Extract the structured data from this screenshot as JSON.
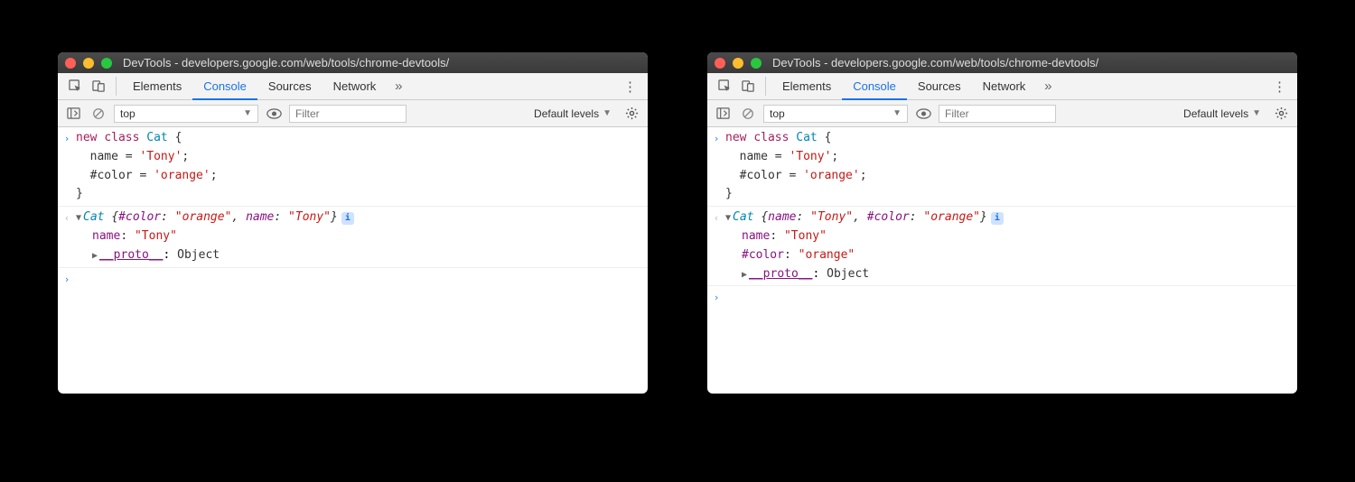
{
  "windows": [
    {
      "title": "DevTools - developers.google.com/web/tools/chrome-devtools/",
      "tabs": {
        "items": [
          "Elements",
          "Console",
          "Sources",
          "Network"
        ],
        "active": "Console"
      },
      "toolbar": {
        "context": "top",
        "filter_placeholder": "Filter",
        "levels": "Default levels"
      },
      "console": {
        "input_lines": [
          {
            "tokens": [
              {
                "t": "kw",
                "s": "new "
              },
              {
                "t": "kw",
                "s": "class "
              },
              {
                "t": "cls",
                "s": "Cat"
              },
              {
                "t": "plain",
                "s": " {"
              }
            ]
          },
          {
            "tokens": [
              {
                "t": "plain",
                "s": "  name = "
              },
              {
                "t": "str",
                "s": "'Tony'"
              },
              {
                "t": "plain",
                "s": ";"
              }
            ]
          },
          {
            "tokens": [
              {
                "t": "plain",
                "s": "  #color = "
              },
              {
                "t": "str",
                "s": "'orange'"
              },
              {
                "t": "plain",
                "s": ";"
              }
            ]
          },
          {
            "tokens": [
              {
                "t": "plain",
                "s": "}"
              }
            ]
          }
        ],
        "output": {
          "header_tokens": [
            {
              "t": "cls",
              "s": "Cat "
            },
            {
              "t": "plain",
              "s": "{"
            },
            {
              "t": "attr",
              "s": "#color"
            },
            {
              "t": "plain",
              "s": ": "
            },
            {
              "t": "str",
              "s": "\"orange\""
            },
            {
              "t": "plain",
              "s": ", "
            },
            {
              "t": "attr",
              "s": "name"
            },
            {
              "t": "plain",
              "s": ": "
            },
            {
              "t": "str",
              "s": "\"Tony\""
            },
            {
              "t": "plain",
              "s": "}"
            }
          ],
          "props": [
            [
              {
                "t": "attr",
                "s": "name"
              },
              {
                "t": "plain",
                "s": ": "
              },
              {
                "t": "str",
                "s": "\"Tony\""
              }
            ]
          ],
          "proto_label": "__proto__",
          "proto_value": "Object"
        }
      }
    },
    {
      "title": "DevTools - developers.google.com/web/tools/chrome-devtools/",
      "tabs": {
        "items": [
          "Elements",
          "Console",
          "Sources",
          "Network"
        ],
        "active": "Console"
      },
      "toolbar": {
        "context": "top",
        "filter_placeholder": "Filter",
        "levels": "Default levels"
      },
      "console": {
        "input_lines": [
          {
            "tokens": [
              {
                "t": "kw",
                "s": "new "
              },
              {
                "t": "kw",
                "s": "class "
              },
              {
                "t": "cls",
                "s": "Cat"
              },
              {
                "t": "plain",
                "s": " {"
              }
            ]
          },
          {
            "tokens": [
              {
                "t": "plain",
                "s": "  name = "
              },
              {
                "t": "str",
                "s": "'Tony'"
              },
              {
                "t": "plain",
                "s": ";"
              }
            ]
          },
          {
            "tokens": [
              {
                "t": "plain",
                "s": "  #color = "
              },
              {
                "t": "str",
                "s": "'orange'"
              },
              {
                "t": "plain",
                "s": ";"
              }
            ]
          },
          {
            "tokens": [
              {
                "t": "plain",
                "s": "}"
              }
            ]
          }
        ],
        "output": {
          "header_tokens": [
            {
              "t": "cls",
              "s": "Cat "
            },
            {
              "t": "plain",
              "s": "{"
            },
            {
              "t": "attr",
              "s": "name"
            },
            {
              "t": "plain",
              "s": ": "
            },
            {
              "t": "str",
              "s": "\"Tony\""
            },
            {
              "t": "plain",
              "s": ", "
            },
            {
              "t": "attr",
              "s": "#color"
            },
            {
              "t": "plain",
              "s": ": "
            },
            {
              "t": "str",
              "s": "\"orange\""
            },
            {
              "t": "plain",
              "s": "}"
            }
          ],
          "props": [
            [
              {
                "t": "attr",
                "s": "name"
              },
              {
                "t": "plain",
                "s": ": "
              },
              {
                "t": "str",
                "s": "\"Tony\""
              }
            ],
            [
              {
                "t": "attr",
                "s": "#color"
              },
              {
                "t": "plain",
                "s": ": "
              },
              {
                "t": "str",
                "s": "\"orange\""
              }
            ]
          ],
          "proto_label": "__proto__",
          "proto_value": "Object"
        }
      }
    }
  ]
}
